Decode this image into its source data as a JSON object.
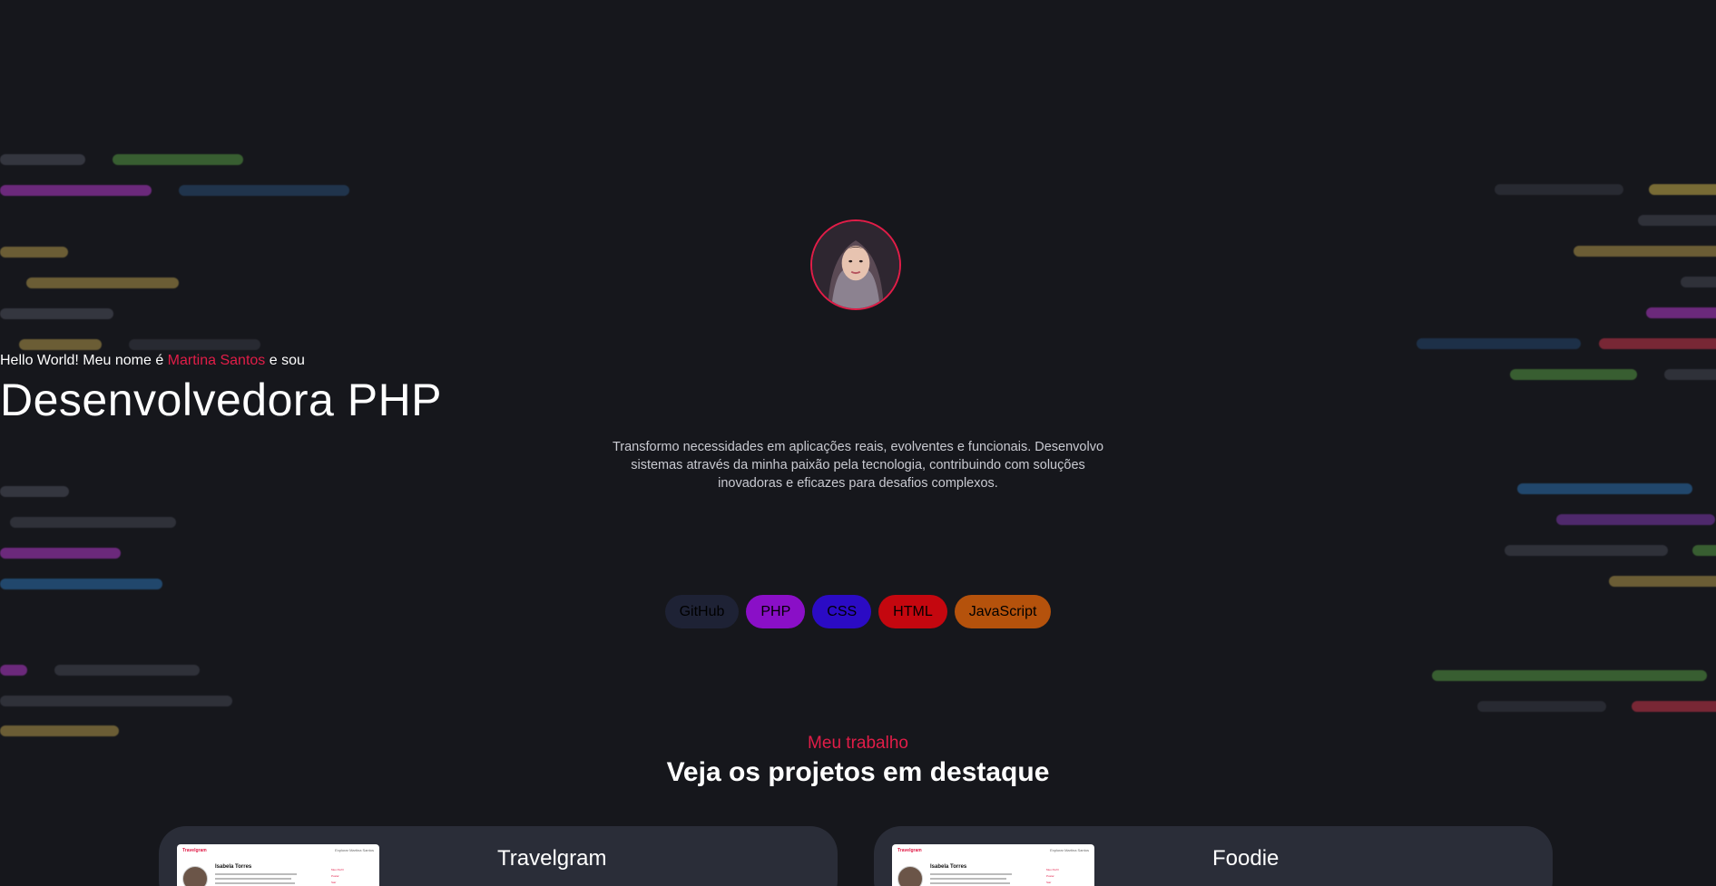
{
  "hero": {
    "intro_before": "Hello World! Meu nome é ",
    "intro_name": "Martina Santos",
    "intro_after": " e sou",
    "role": "Desenvolvedora PHP",
    "description": "Transformo necessidades em aplicações reais, evolventes e funcionais. Desenvolvo sistemas através da minha paixão pela tecnologia, contribuindo com soluções inovadoras e eficazes para desafios complexos."
  },
  "tags": [
    {
      "label": "GitHub",
      "color": "#1e2235"
    },
    {
      "label": "PHP",
      "color": "#8a0fc7"
    },
    {
      "label": "CSS",
      "color": "#2b0bc4"
    },
    {
      "label": "HTML",
      "color": "#c4070f"
    },
    {
      "label": "JavaScript",
      "color": "#b5520c"
    }
  ],
  "section": {
    "kicker": "Meu trabalho",
    "title": "Veja os projetos em destaque"
  },
  "projects": [
    {
      "title": "Travelgram",
      "thumb_brand": "Travelgram",
      "thumb_nav": "Explorar   Martina Santos",
      "thumb_name": "Isabela Torres",
      "thumb_items": [
        "Meu Perfil",
        "Postar",
        "Sair"
      ]
    },
    {
      "title": "Foodie",
      "thumb_brand": "Travelgram",
      "thumb_nav": "Explorar   Martina Santos",
      "thumb_name": "Isabela Torres",
      "thumb_items": [
        "Meu Perfil",
        "Postar",
        "Sair"
      ]
    }
  ],
  "colors": {
    "accent": "#e11d48",
    "background": "#16171c",
    "card": "#2a2d38"
  }
}
